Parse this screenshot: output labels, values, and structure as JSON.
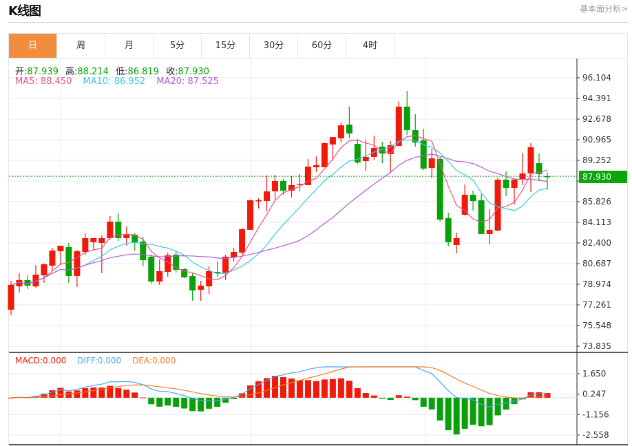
{
  "header": {
    "title": "K线图",
    "link": "基本面分析>"
  },
  "tabs": [
    {
      "label": "日",
      "active": true
    },
    {
      "label": "周"
    },
    {
      "label": "月"
    },
    {
      "label": "5分"
    },
    {
      "label": "15分"
    },
    {
      "label": "30分"
    },
    {
      "label": "60分"
    },
    {
      "label": "4时"
    }
  ],
  "info": {
    "open_label": "开:",
    "open": "87.939",
    "high_label": "高:",
    "high": "88.214",
    "low_label": "低:",
    "low": "86.819",
    "close_label": "收:",
    "close": "87.930",
    "ma5": "MA5: 88.450",
    "ma10": "MA10: 86.952",
    "ma20": "MA20: 87.525"
  },
  "macd_info": {
    "macd": "MACD:0.000",
    "diff": "DIFF:0.000",
    "dea": "DEA:0.000"
  },
  "last_price": "87.930",
  "colors": {
    "up": "#f01a0a",
    "down": "#0aa00a",
    "ma5": "#f0508a",
    "ma10": "#3cc8dc",
    "ma20": "#b45ad2",
    "diff": "#4aa6f0",
    "dea": "#f07c20",
    "accent": "#f28c3f"
  },
  "chart_data": {
    "type": "candlestick",
    "ylim": [
      73.835,
      96.104
    ],
    "y_ticks": [
      "96.104",
      "94.391",
      "92.678",
      "90.965",
      "89.252",
      "85.826",
      "84.113",
      "82.400",
      "80.687",
      "78.974",
      "77.261",
      "75.548",
      "73.835"
    ],
    "macd_ylim": [
      -2.558,
      1.65
    ],
    "macd_ticks": [
      "1.650",
      "0.247",
      "-1.156",
      "-2.558"
    ],
    "ohlc": [
      [
        76.86,
        79.26,
        76.4,
        78.92
      ],
      [
        78.8,
        79.89,
        78.29,
        79.32
      ],
      [
        79.32,
        79.72,
        78.57,
        78.86
      ],
      [
        78.8,
        80.57,
        78.69,
        79.77
      ],
      [
        79.72,
        80.69,
        79.09,
        80.63
      ],
      [
        80.52,
        82.0,
        80.12,
        81.77
      ],
      [
        81.71,
        82.17,
        80.57,
        82.17
      ],
      [
        82.06,
        82.4,
        79.09,
        79.66
      ],
      [
        79.66,
        81.83,
        78.75,
        81.71
      ],
      [
        81.66,
        83.2,
        81.43,
        82.8
      ],
      [
        82.46,
        82.8,
        81.83,
        82.8
      ],
      [
        82.4,
        83.03,
        79.89,
        82.8
      ],
      [
        82.8,
        84.63,
        82.69,
        84.17
      ],
      [
        84.17,
        84.86,
        82.57,
        82.8
      ],
      [
        82.8,
        83.77,
        82.17,
        83.09
      ],
      [
        83.09,
        83.2,
        81.77,
        82.46
      ],
      [
        82.51,
        82.91,
        80.46,
        80.97
      ],
      [
        81.26,
        81.43,
        79.03,
        79.2
      ],
      [
        79.2,
        81.03,
        78.92,
        80.06
      ],
      [
        80.0,
        81.6,
        79.6,
        81.37
      ],
      [
        81.43,
        81.71,
        79.94,
        80.17
      ],
      [
        80.23,
        80.34,
        79.49,
        79.54
      ],
      [
        79.66,
        79.94,
        77.6,
        78.46
      ],
      [
        78.52,
        79.26,
        77.6,
        78.86
      ],
      [
        78.8,
        80.46,
        78.17,
        80.06
      ],
      [
        80.0,
        80.86,
        79.6,
        79.89
      ],
      [
        79.89,
        81.43,
        79.32,
        81.26
      ],
      [
        81.2,
        82.0,
        80.86,
        81.66
      ],
      [
        81.6,
        83.66,
        81.43,
        83.54
      ],
      [
        83.49,
        86.0,
        83.49,
        85.94
      ],
      [
        85.88,
        86.11,
        85.26,
        85.94
      ],
      [
        85.88,
        88.0,
        85.03,
        86.68
      ],
      [
        86.68,
        88.05,
        86.0,
        87.54
      ],
      [
        87.54,
        87.71,
        86.4,
        86.74
      ],
      [
        86.74,
        87.94,
        86.17,
        87.2
      ],
      [
        87.25,
        88.11,
        86.68,
        87.31
      ],
      [
        87.2,
        89.37,
        87.2,
        88.74
      ],
      [
        88.68,
        89.59,
        88.28,
        88.85
      ],
      [
        88.68,
        90.74,
        88.68,
        90.68
      ],
      [
        90.57,
        91.19,
        89.25,
        91.19
      ],
      [
        91.08,
        92.39,
        90.74,
        92.16
      ],
      [
        92.22,
        93.71,
        91.08,
        91.48
      ],
      [
        90.62,
        91.02,
        88.97,
        89.08
      ],
      [
        89.19,
        90.97,
        88.39,
        89.54
      ],
      [
        89.54,
        91.31,
        89.31,
        90.28
      ],
      [
        90.39,
        90.79,
        89.02,
        89.82
      ],
      [
        89.77,
        90.85,
        88.22,
        90.51
      ],
      [
        90.45,
        94.16,
        90.45,
        93.71
      ],
      [
        93.71,
        95.02,
        91.37,
        91.76
      ],
      [
        91.76,
        93.08,
        90.39,
        90.74
      ],
      [
        90.91,
        91.88,
        88.45,
        88.57
      ],
      [
        88.62,
        90.22,
        87.77,
        89.42
      ],
      [
        89.37,
        89.54,
        84.17,
        84.34
      ],
      [
        84.46,
        84.91,
        82.11,
        82.46
      ],
      [
        82.23,
        83.26,
        81.54,
        82.8
      ],
      [
        84.74,
        87.25,
        84.68,
        86.4
      ],
      [
        86.4,
        86.74,
        85.08,
        85.88
      ],
      [
        85.94,
        86.45,
        83.14,
        83.14
      ],
      [
        83.14,
        85.2,
        82.29,
        83.49
      ],
      [
        83.43,
        87.82,
        83.37,
        87.65
      ],
      [
        87.65,
        88.34,
        86.28,
        86.97
      ],
      [
        86.97,
        87.71,
        85.6,
        87.65
      ],
      [
        87.71,
        89.88,
        87.2,
        88.17
      ],
      [
        88.17,
        90.68,
        86.63,
        90.34
      ],
      [
        89.02,
        89.82,
        87.54,
        88.11
      ],
      [
        87.939,
        88.214,
        86.819,
        87.93
      ]
    ]
  }
}
